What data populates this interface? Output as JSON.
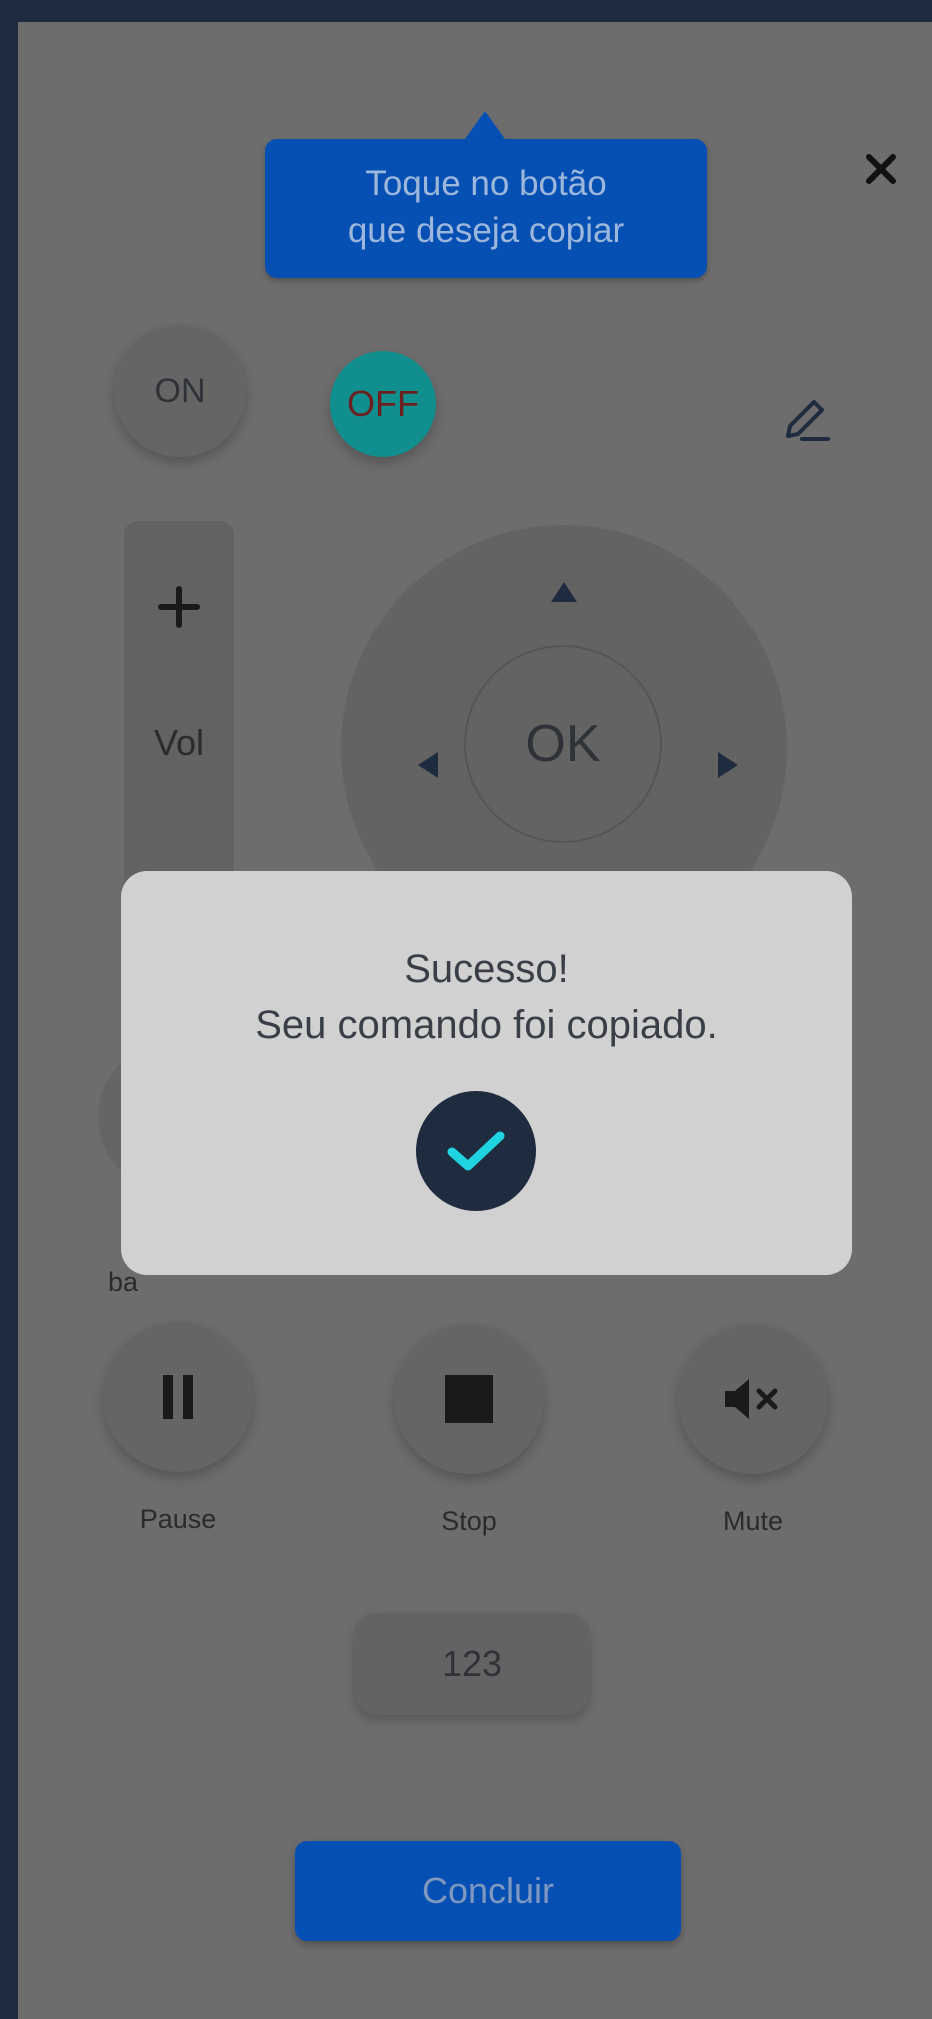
{
  "tooltip": {
    "line1": "Toque no botão",
    "line2": "que deseja copiar"
  },
  "controls": {
    "on_label": "ON",
    "off_label": "OFF",
    "vol_label": "Vol",
    "ok_label": "OK"
  },
  "buttons": [
    {
      "label": "Pause",
      "icon": "pause-icon"
    },
    {
      "label": "Stop",
      "icon": "stop-icon"
    },
    {
      "label": "Mute",
      "icon": "mute-icon"
    }
  ],
  "partial_label": "ba",
  "numbers_label": "123",
  "done_label": "Concluir",
  "modal": {
    "title": "Sucesso!",
    "message": "Seu comando foi copiado."
  },
  "colors": {
    "accent": "#0650b4",
    "overlay": "#6d6d6d",
    "teal": "#118f8e",
    "frame": "#1f2b3e",
    "check": "#1fd3e0"
  }
}
